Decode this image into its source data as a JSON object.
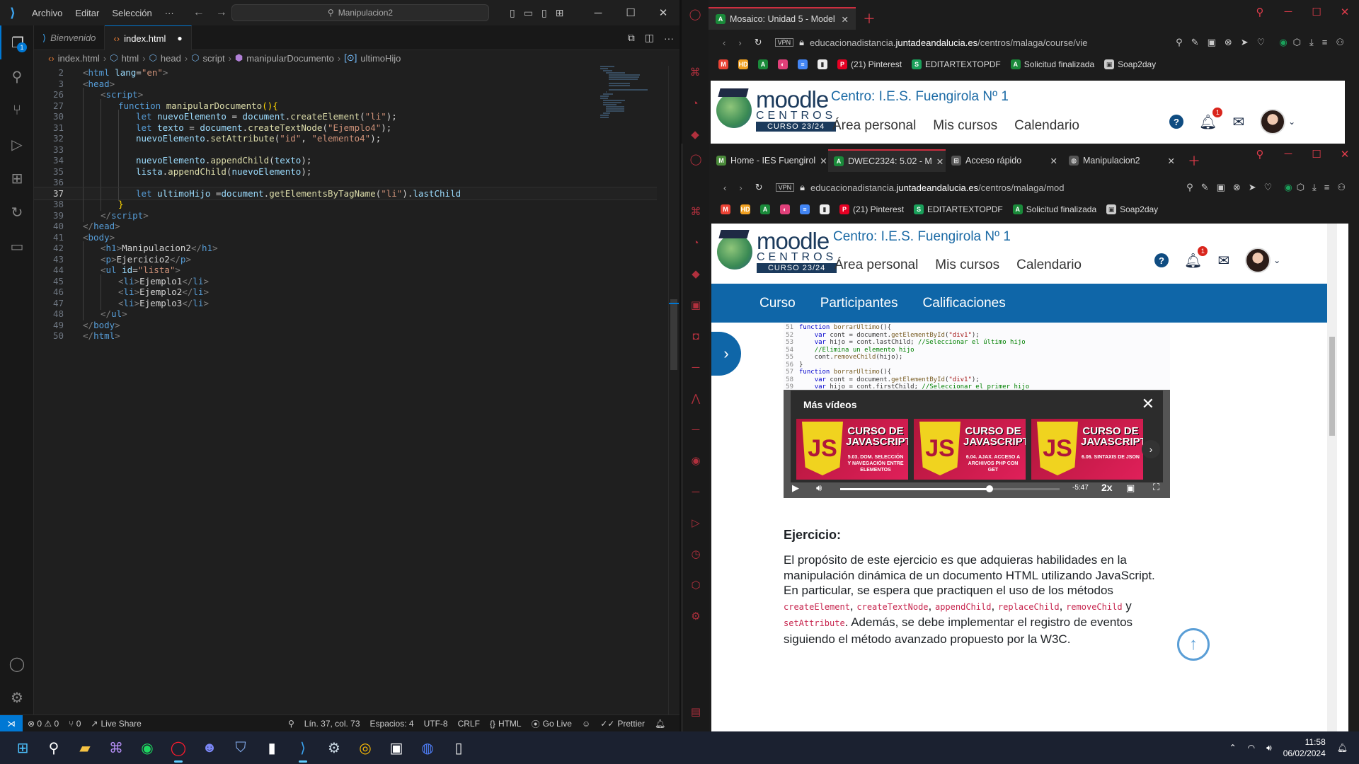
{
  "vscode": {
    "menu": [
      "Archivo",
      "Editar",
      "Selección",
      "···"
    ],
    "search": "Manipulacion2",
    "explorer_badge": "1",
    "tabs": [
      {
        "label": "Bienvenido",
        "active": false
      },
      {
        "label": "index.html",
        "active": true,
        "modified_dot": "●"
      }
    ],
    "breadcrumb": [
      "index.html",
      "html",
      "head",
      "script",
      "manipularDocumento",
      "ultimoHijo"
    ],
    "code_lines": [
      {
        "n": "2",
        "html": "<span class='t-br'>&lt;</span><span class='t-tag'>html</span> <span class='t-attr'>lang</span><span class='t-txt'>=</span><span class='t-str'>\"en\"</span><span class='t-br'>&gt;</span>",
        "indent": 0
      },
      {
        "n": "3",
        "html": "<span class='t-br'>&lt;</span><span class='t-tag'>head</span><span class='t-br'>&gt;</span>",
        "indent": 0
      },
      {
        "n": "26",
        "html": "<span class='t-br'>&lt;</span><span class='t-tag'>script</span><span class='t-br'>&gt;</span>",
        "indent": 1
      },
      {
        "n": "27",
        "html": "<span class='t-kw'>function</span> <span class='t-fn'>manipularDocumento</span><span class='t-fn2'>(){</span>",
        "indent": 2
      },
      {
        "n": "30",
        "html": "<span class='t-kw'>let</span> <span class='t-var'>nuevoElemento</span> <span class='t-txt'>=</span> <span class='t-var'>document</span><span class='t-txt'>.</span><span class='t-fn'>createElement</span><span class='t-txt'>(</span><span class='t-str'>\"li\"</span><span class='t-txt'>);</span>",
        "indent": 3
      },
      {
        "n": "31",
        "html": "<span class='t-kw'>let</span> <span class='t-var'>texto</span> <span class='t-txt'>=</span> <span class='t-var'>document</span><span class='t-txt'>.</span><span class='t-fn'>createTextNode</span><span class='t-txt'>(</span><span class='t-str'>\"Ejemplo4\"</span><span class='t-txt'>);</span>",
        "indent": 3
      },
      {
        "n": "32",
        "html": "<span class='t-var'>nuevoElemento</span><span class='t-txt'>.</span><span class='t-fn'>setAttribute</span><span class='t-txt'>(</span><span class='t-str'>\"id\"</span><span class='t-txt'>, </span><span class='t-str'>\"elemento4\"</span><span class='t-txt'>);</span>",
        "indent": 3
      },
      {
        "n": "33",
        "html": "",
        "indent": 3
      },
      {
        "n": "34",
        "html": "<span class='t-var'>nuevoElemento</span><span class='t-txt'>.</span><span class='t-fn'>appendChild</span><span class='t-txt'>(</span><span class='t-var'>texto</span><span class='t-txt'>);</span>",
        "indent": 3
      },
      {
        "n": "35",
        "html": "<span class='t-var'>lista</span><span class='t-txt'>.</span><span class='t-fn'>appendChild</span><span class='t-txt'>(</span><span class='t-var'>nuevoElemento</span><span class='t-txt'>);</span>",
        "indent": 3
      },
      {
        "n": "36",
        "html": "",
        "indent": 3
      },
      {
        "n": "37",
        "html": "<span class='t-kw'>let</span> <span class='t-var'>ultimoHijo</span> <span class='t-txt'>=</span><span class='t-var'>document</span><span class='t-txt'>.</span><span class='t-fn'>getElementsByTagName</span><span class='t-txt'>(</span><span class='t-str'>\"li\"</span><span class='t-txt'>).</span><span class='t-var'>lastChild</span>",
        "indent": 3,
        "current": true
      },
      {
        "n": "38",
        "html": "<span class='t-fn2'>}</span>",
        "indent": 2
      },
      {
        "n": "39",
        "html": "<span class='t-br'>&lt;/</span><span class='t-tag'>script</span><span class='t-br'>&gt;</span>",
        "indent": 1
      },
      {
        "n": "40",
        "html": "<span class='t-br'>&lt;/</span><span class='t-tag'>head</span><span class='t-br'>&gt;</span>",
        "indent": 0
      },
      {
        "n": "41",
        "html": "<span class='t-br'>&lt;</span><span class='t-tag'>body</span><span class='t-br'>&gt;</span>",
        "indent": 0
      },
      {
        "n": "42",
        "html": "<span class='t-br'>&lt;</span><span class='t-tag'>h1</span><span class='t-br'>&gt;</span><span class='t-txt'>Manipulacion2</span><span class='t-br'>&lt;/</span><span class='t-tag'>h1</span><span class='t-br'>&gt;</span>",
        "indent": 1
      },
      {
        "n": "43",
        "html": "<span class='t-br'>&lt;</span><span class='t-tag'>p</span><span class='t-br'>&gt;</span><span class='t-txt'>Ejercicio2</span><span class='t-br'>&lt;/</span><span class='t-tag'>p</span><span class='t-br'>&gt;</span>",
        "indent": 1
      },
      {
        "n": "44",
        "html": "<span class='t-br'>&lt;</span><span class='t-tag'>ul</span> <span class='t-attr'>id</span><span class='t-txt'>=</span><span class='t-str'>\"lista\"</span><span class='t-br'>&gt;</span>",
        "indent": 1
      },
      {
        "n": "45",
        "html": "<span class='t-br'>&lt;</span><span class='t-tag'>li</span><span class='t-br'>&gt;</span><span class='t-txt'>Ejemplo1</span><span class='t-br'>&lt;/</span><span class='t-tag'>li</span><span class='t-br'>&gt;</span>",
        "indent": 2
      },
      {
        "n": "46",
        "html": "<span class='t-br'>&lt;</span><span class='t-tag'>li</span><span class='t-br'>&gt;</span><span class='t-txt'>Ejemplo2</span><span class='t-br'>&lt;/</span><span class='t-tag'>li</span><span class='t-br'>&gt;</span>",
        "indent": 2
      },
      {
        "n": "47",
        "html": "<span class='t-br'>&lt;</span><span class='t-tag'>li</span><span class='t-br'>&gt;</span><span class='t-txt'>Ejemplo3</span><span class='t-br'>&lt;/</span><span class='t-tag'>li</span><span class='t-br'>&gt;</span>",
        "indent": 2
      },
      {
        "n": "48",
        "html": "<span class='t-br'>&lt;/</span><span class='t-tag'>ul</span><span class='t-br'>&gt;</span>",
        "indent": 1
      },
      {
        "n": "49",
        "html": "<span class='t-br'>&lt;/</span><span class='t-tag'>body</span><span class='t-br'>&gt;</span>",
        "indent": 0
      },
      {
        "n": "50",
        "html": "<span class='t-br'>&lt;/</span><span class='t-tag'>html</span><span class='t-br'>&gt;</span>",
        "indent": 0
      }
    ],
    "status": {
      "problems": "⊗ 0 ⚠ 0",
      "ports": "⑂ 0",
      "live_share": "Live Share",
      "position": "Lín. 37, col. 73",
      "spaces": "Espacios: 4",
      "encoding": "UTF-8",
      "eol": "CRLF",
      "language": "HTML",
      "golive": "Go Live",
      "prettier": "Prettier"
    }
  },
  "opera_back": {
    "tab_title": "Mosaico: Unidad 5 - Model",
    "url_host_pre": "educacionadistancia.",
    "url_host_main": "juntadeandalucia.es",
    "url_path": "/centros/malaga/course/vie",
    "vpn": "VPN"
  },
  "opera_front": {
    "tabs": [
      {
        "label": "Home - IES Fuengirol",
        "fav": "M",
        "favcolor": "#4a8a3a"
      },
      {
        "label": "DWEC2324: 5.02 - M",
        "fav": "A",
        "favcolor": "#1a8a3a",
        "active": true
      },
      {
        "label": "Acceso rápido",
        "fav": "⊞",
        "favcolor": "#555"
      },
      {
        "label": "Manipulacion2",
        "fav": "◍",
        "favcolor": "#555"
      }
    ],
    "url_host_pre": "educacionadistancia.",
    "url_host_main": "juntadeandalucia.es",
    "url_path": "/centros/malaga/mod",
    "vpn": "VPN"
  },
  "bookmarks": [
    {
      "label": "",
      "ico": "M",
      "color": "#ea4335"
    },
    {
      "label": "",
      "ico": "HD",
      "color": "#f0a020"
    },
    {
      "label": "",
      "ico": "A",
      "color": "#1a8a3a"
    },
    {
      "label": "",
      "ico": "◐",
      "color": "#e0407a"
    },
    {
      "label": "",
      "ico": "≡",
      "color": "#4285f4"
    },
    {
      "label": "",
      "ico": "▮",
      "color": "#eee"
    },
    {
      "label": "(21) Pinterest",
      "ico": "P",
      "color": "#e60023"
    },
    {
      "label": "EDITARTEXTOPDF",
      "ico": "S",
      "color": "#1aa05a"
    },
    {
      "label": "Solicitud finalizada",
      "ico": "A",
      "color": "#1a8a3a"
    },
    {
      "label": "Soap2day",
      "ico": "▣",
      "color": "#ccc"
    }
  ],
  "moodle": {
    "logo_word": "moodle",
    "logo_centros": "CENTROS",
    "logo_curso": "CURSO 23/24",
    "centro": "Centro:  I.E.S. Fuengirola Nº 1",
    "nav": [
      "Área personal",
      "Mis cursos",
      "Calendario"
    ],
    "notif_count": "1",
    "course_nav": [
      "Curso",
      "Participantes",
      "Calificaciones"
    ]
  },
  "video": {
    "code_lines": [
      {
        "n": "51",
        "html": "<span class='k'>function</span> <span class='f'>borrarUltimo</span>(){"
      },
      {
        "n": "52",
        "html": "&nbsp;&nbsp;&nbsp;&nbsp;<span class='k'>var</span> cont = document.<span class='f'>getElementById</span>(<span class='s'>\"div1\"</span>);"
      },
      {
        "n": "53",
        "html": "&nbsp;&nbsp;&nbsp;&nbsp;<span class='k'>var</span> hijo = cont.lastChild; <span class='c'>//Seleccionar el último hijo</span>"
      },
      {
        "n": "54",
        "html": "&nbsp;&nbsp;&nbsp;&nbsp;<span class='c'>//Elimina un elemento hijo</span>"
      },
      {
        "n": "55",
        "html": "&nbsp;&nbsp;&nbsp;&nbsp;cont.<span class='f'>removeChild</span>(hijo);"
      },
      {
        "n": "56",
        "html": "}"
      },
      {
        "n": "57",
        "html": "<span class='k'>function</span> <span class='f'>borrarUltimo</span>(){"
      },
      {
        "n": "58",
        "html": "&nbsp;&nbsp;&nbsp;&nbsp;<span class='k'>var</span> cont = document.<span class='f'>getElementById</span>(<span class='s'>\"div1\"</span>);"
      },
      {
        "n": "59",
        "html": "&nbsp;&nbsp;&nbsp;&nbsp;<span class='k'>var</span> hijo = cont.firstChild; <span class='c'>//Seleccionar el primer hijo</span>"
      }
    ],
    "mas_videos": "Más vídeos",
    "thumbs": [
      {
        "title": "CURSO DE JAVASCRIPT",
        "sub": "5.03. DOM. SELECCIÓN Y NAVEGACIÓN ENTRE ELEMENTOS"
      },
      {
        "title": "CURSO DE JAVASCRIPT",
        "sub": "6.04. AJAX. ACCESO A ARCHIVOS PHP CON GET"
      },
      {
        "title": "CURSO DE JAVASCRIPT",
        "sub": "6.06. SINTAXIS DE JSON"
      }
    ],
    "time": "-5:47",
    "speed": "2x",
    "progress": 0.68
  },
  "exercise": {
    "heading": "Ejercicio:",
    "p1": "El propósito de este ejercicio es que adquieras habilidades en la manipulación dinámica de un documento HTML utilizando JavaScript. En particular, se espera que practiquen el uso de los métodos ",
    "m1": "createElement",
    "c1": ", ",
    "m2": "createTextNode",
    "c2": ", ",
    "m3": "appendChild",
    "c3": ", ",
    "m4": "replaceChild",
    "c4": ", ",
    "m5": "removeChild",
    "c5": " y ",
    "m6": "setAttribute",
    "p2": ". Además, se debe implementar el registro de eventos siguiendo el método avanzado propuesto por la W3C."
  },
  "taskbar": {
    "time": "11:58",
    "date": "06/02/2024"
  }
}
